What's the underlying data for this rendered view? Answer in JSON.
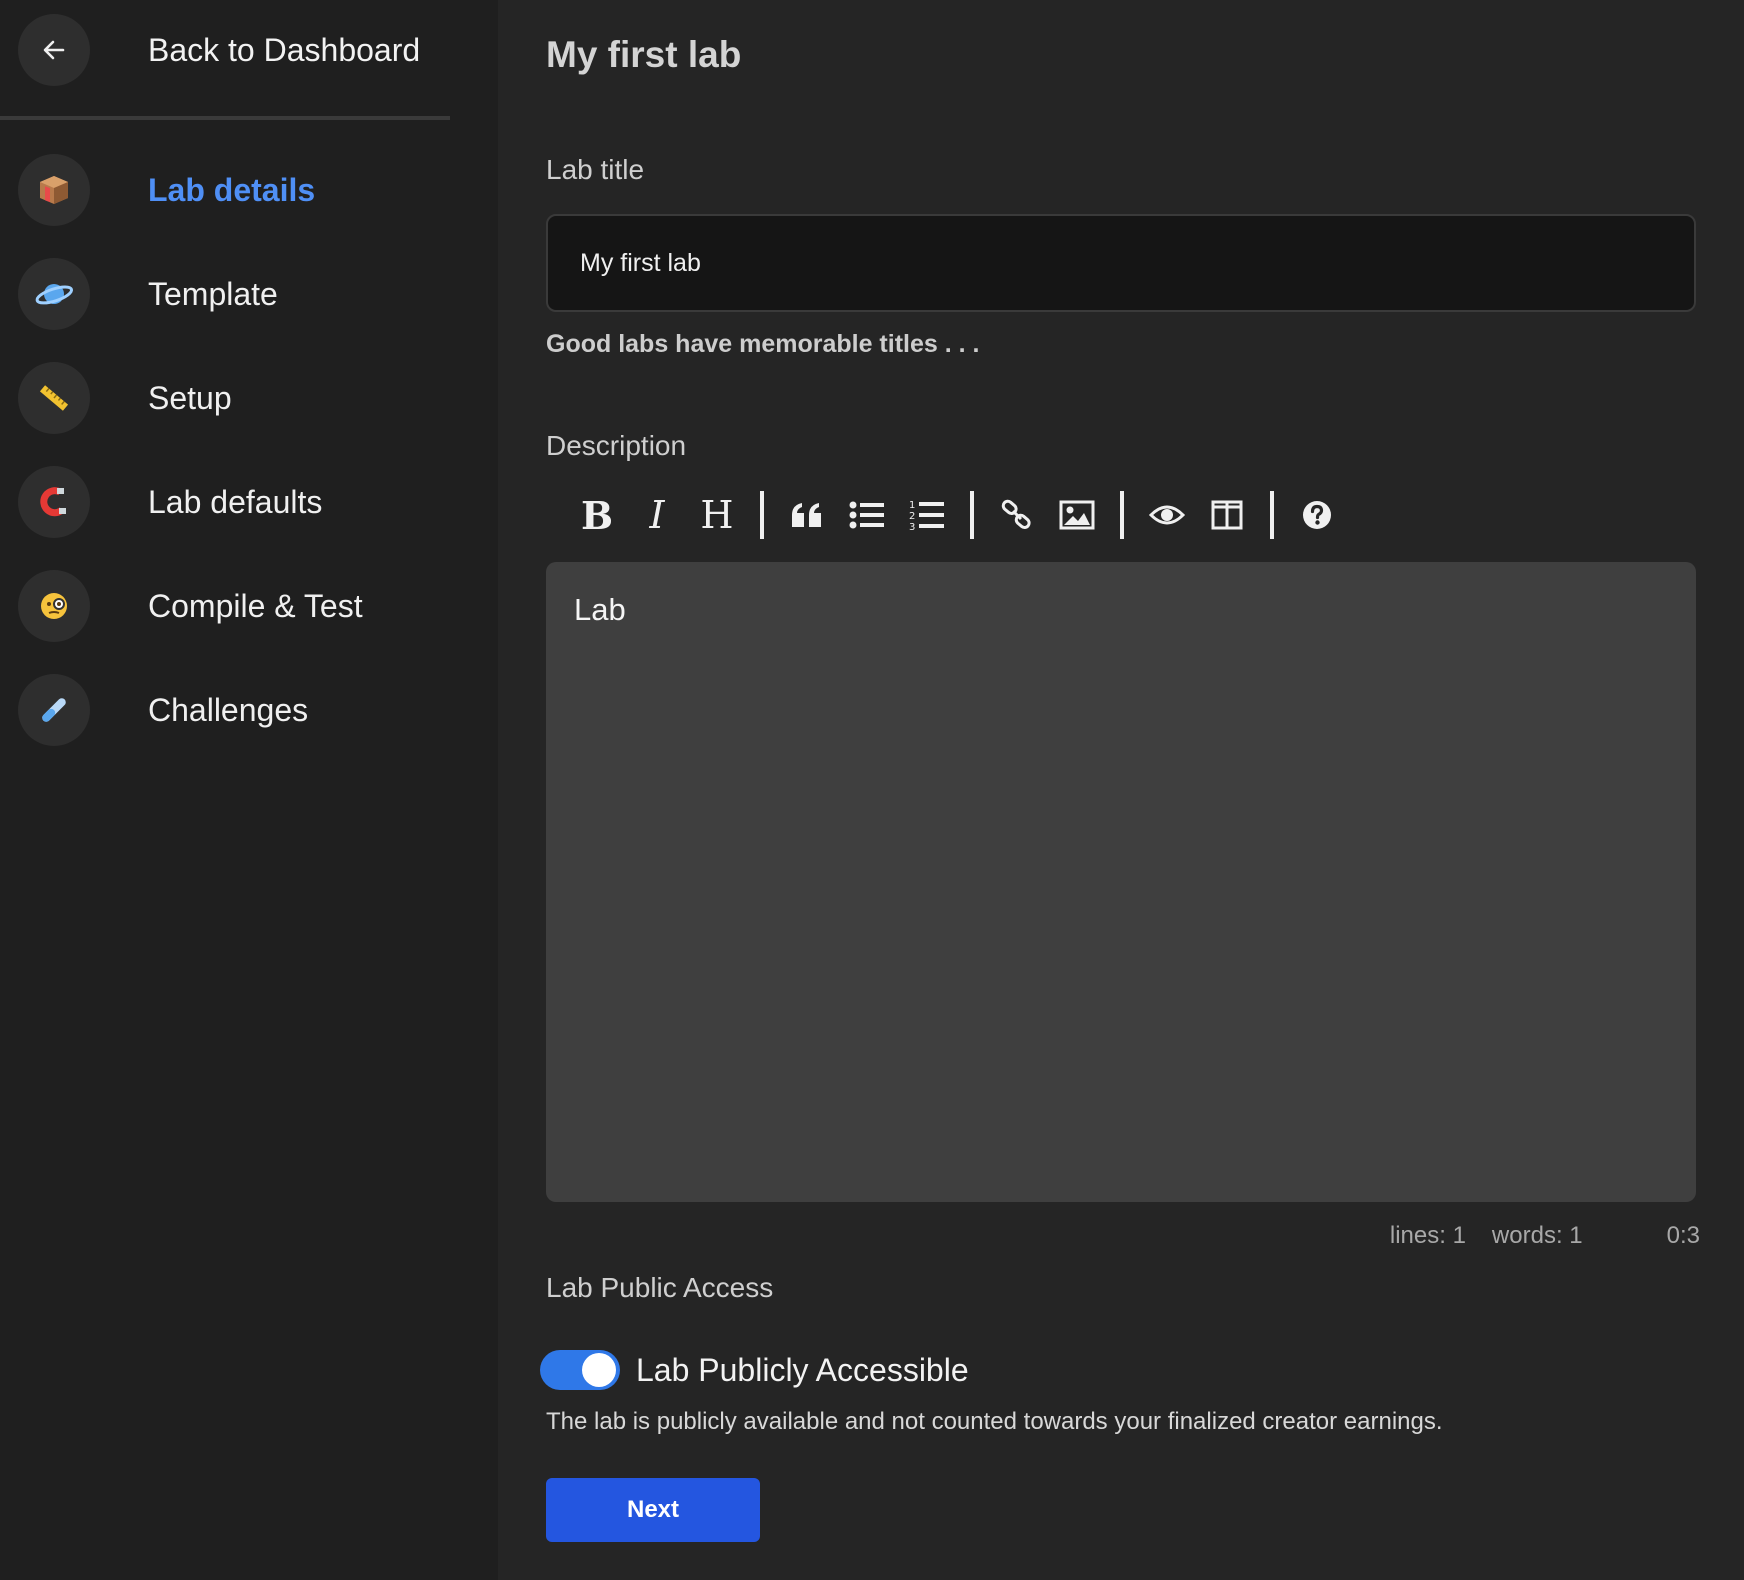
{
  "sidebar": {
    "back_label": "Back to Dashboard",
    "items": [
      {
        "label": "Lab details",
        "icon": "package-icon",
        "active": true
      },
      {
        "label": "Template",
        "icon": "planet-icon",
        "active": false
      },
      {
        "label": "Setup",
        "icon": "ruler-icon",
        "active": false
      },
      {
        "label": "Lab defaults",
        "icon": "magnet-icon",
        "active": false
      },
      {
        "label": "Compile & Test",
        "icon": "monocle-face-icon",
        "active": false
      },
      {
        "label": "Challenges",
        "icon": "test-tube-icon",
        "active": false
      }
    ]
  },
  "main": {
    "page_title": "My first lab",
    "title_label": "Lab title",
    "title_value": "My first lab",
    "title_hint": "Good labs have memorable titles . . .",
    "description_label": "Description",
    "toolbar": {
      "bold": "B",
      "italic": "I",
      "heading": "H"
    },
    "editor_content": "Lab",
    "status": {
      "lines": "lines: 1",
      "words": "words: 1",
      "cursor": "0:3"
    },
    "access_label": "Lab Public Access",
    "toggle_label": "Lab Publicly Accessible",
    "toggle_on": true,
    "access_description": "The lab is publicly available and not counted towards your finalized creator earnings.",
    "next_label": "Next"
  },
  "colors": {
    "accent": "#4f8ff5",
    "primary_button": "#2456e0",
    "toggle": "#2f78e8",
    "sidebar_bg": "#1f1f1f",
    "main_bg": "#252525"
  }
}
